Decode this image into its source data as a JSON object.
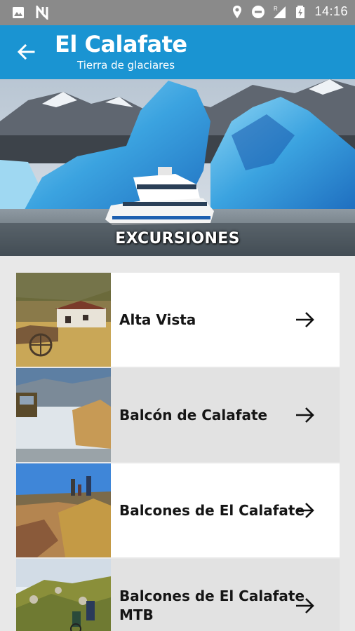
{
  "status_bar": {
    "time": "14:16",
    "icons": [
      "image-icon",
      "n-badge-icon",
      "location-icon",
      "do-not-disturb-icon",
      "signal-roaming-icon",
      "battery-charging-icon"
    ],
    "roaming_letter": "R"
  },
  "app_bar": {
    "title": "El Calafate",
    "subtitle": "Tierra de glaciares",
    "color": "#1a94d2"
  },
  "hero": {
    "title": "EXCURSIONES"
  },
  "excursions": [
    {
      "label": "Alta Vista",
      "icon": "arrow-right-icon"
    },
    {
      "label": "Balcón de Calafate",
      "icon": "arrow-right-icon"
    },
    {
      "label": "Balcones de El Calafate",
      "icon": "arrow-right-icon"
    },
    {
      "label_line1": "Balcones de El Calafate",
      "label_line2": "MTB",
      "icon": "arrow-right-icon"
    }
  ]
}
